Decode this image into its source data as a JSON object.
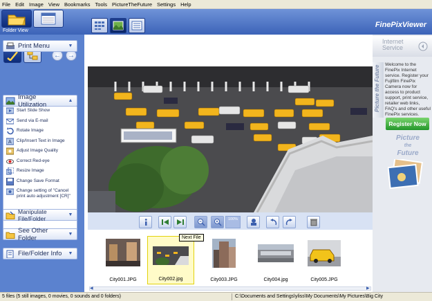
{
  "menu": [
    "File",
    "Edit",
    "Image",
    "View",
    "Bookmarks",
    "Tools",
    "PictureTheFuture",
    "Settings",
    "Help"
  ],
  "header": {
    "folder_view_label": "Folder View",
    "brand": "FinePixViewer"
  },
  "left_panel": {
    "sections": [
      {
        "label": "Print Menu"
      },
      {
        "label": "Image Utilization"
      },
      {
        "label": "Manipulate File/Folder"
      },
      {
        "label": "See Other Folder"
      },
      {
        "label": "File/Folder Info"
      }
    ],
    "utilization_items": [
      {
        "label": "Start Slide Show",
        "icon": "slideshow-icon"
      },
      {
        "label": "Send via E-mail",
        "icon": "email-icon"
      },
      {
        "label": "Rotate Image",
        "icon": "rotate-icon"
      },
      {
        "label": "Clip/Insert Text in Image",
        "icon": "clip-icon"
      },
      {
        "label": "Adjust Image Quality",
        "icon": "quality-icon"
      },
      {
        "label": "Correct Red-eye",
        "icon": "redeye-icon"
      },
      {
        "label": "Resize Image",
        "icon": "resize-icon"
      },
      {
        "label": "Change Save Format",
        "icon": "save-format-icon"
      },
      {
        "label": "Change setting of \"Cancel print auto adjustment [CR]\"",
        "icon": "settings-icon"
      }
    ]
  },
  "viewer": {
    "zoom_label": "100%",
    "tooltip": "Next File",
    "thumbnails": [
      {
        "name": "City001.JPG"
      },
      {
        "name": "City002.jpg"
      },
      {
        "name": "City003.JPG"
      },
      {
        "name": "City004.jpg"
      },
      {
        "name": "City005.JPG"
      }
    ]
  },
  "right_panel": {
    "title_line1": "Internet",
    "title_line2": "Service",
    "tab_label": "Picture the Future",
    "welcome_text": "Welcome to the FinePix Internet service. Register your Fujifilm FinePix Camera now for access to product support, print service, retailer web links, FAQ's and other useful FinePix services.",
    "register_button": "Register Now",
    "logo_line1": "Picture",
    "logo_line2": "the",
    "logo_line3": "Future"
  },
  "status": {
    "left": "5 files (5 still images, 0 movies, 0 sounds and 0 folders)",
    "path": "C:\\Documents and Settings\\yliss\\My Documents\\My Pictures\\Big City"
  },
  "colors": {
    "header_blue": "#3c63b8",
    "panel_blue": "#5b82cf",
    "register_green": "#23962a",
    "selected_yellow": "#fffbc8"
  }
}
